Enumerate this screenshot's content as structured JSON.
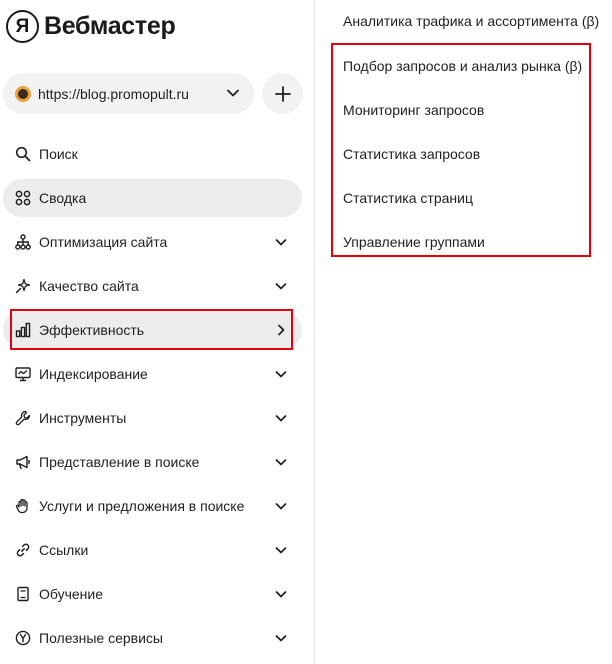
{
  "logo": {
    "badge": "Я",
    "title": "Вебмастер"
  },
  "site_selector": {
    "url": "https://blog.promopult.ru",
    "icon": "chevron-down-icon"
  },
  "add_site": {
    "icon": "plus-icon"
  },
  "sidebar": {
    "items": [
      {
        "label": "Поиск",
        "icon": "search-icon",
        "chevron": "none"
      },
      {
        "label": "Сводка",
        "icon": "dashboard-icon",
        "chevron": "none"
      },
      {
        "label": "Оптимизация сайта",
        "icon": "sitemap-icon",
        "chevron": "down"
      },
      {
        "label": "Качество сайта",
        "icon": "sparkle-icon",
        "chevron": "down"
      },
      {
        "label": "Эффективность",
        "icon": "bar-chart-icon",
        "chevron": "right"
      },
      {
        "label": "Индексирование",
        "icon": "monitor-icon",
        "chevron": "down"
      },
      {
        "label": "Инструменты",
        "icon": "wrench-icon",
        "chevron": "down"
      },
      {
        "label": "Представление в поиске",
        "icon": "megaphone-icon",
        "chevron": "down"
      },
      {
        "label": "Услуги и предложения в поиске",
        "icon": "hand-icon",
        "chevron": "down"
      },
      {
        "label": "Ссылки",
        "icon": "link-icon",
        "chevron": "down"
      },
      {
        "label": "Обучение",
        "icon": "book-icon",
        "chevron": "down"
      },
      {
        "label": "Полезные сервисы",
        "icon": "yandex-icon",
        "chevron": "down"
      }
    ]
  },
  "submenu": {
    "items": [
      {
        "label": "Аналитика трафика и ассортимента (β)"
      },
      {
        "label": "Подбор запросов и анализ рынка (β)"
      },
      {
        "label": "Мониторинг запросов"
      },
      {
        "label": "Статистика запросов"
      },
      {
        "label": "Статистика страниц"
      },
      {
        "label": "Управление группами"
      }
    ]
  },
  "colors": {
    "highlight": "#e3000f",
    "active_bg": "#ececec",
    "pill_bg": "#f2f2f2"
  }
}
